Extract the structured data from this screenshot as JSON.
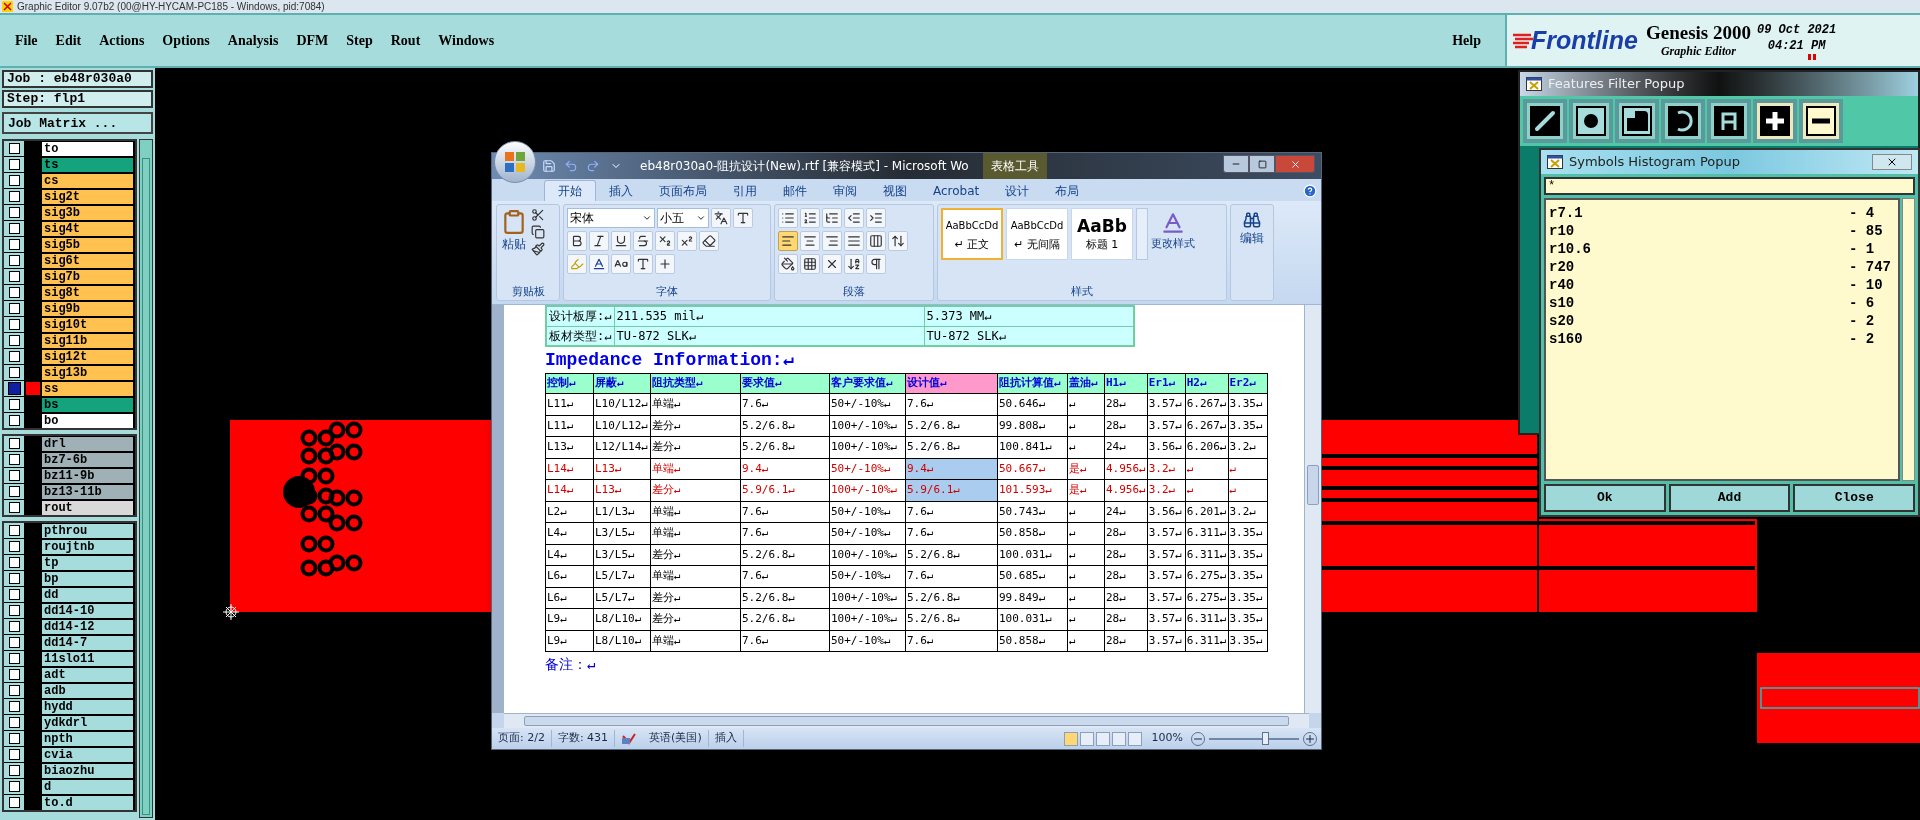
{
  "app_title": "Graphic Editor 9.07b2 (00@HY-HYCAM-PC185 - Windows, pid:7084)",
  "menu": [
    "File",
    "Edit",
    "Actions",
    "Options",
    "Analysis",
    "DFM",
    "Step",
    "Rout",
    "Windows"
  ],
  "help": "Help",
  "brand": {
    "logo": "Frontline",
    "product": "Genesis 2000",
    "subtitle": "Graphic Editor",
    "date": "09 Oct 2021",
    "time": "04:21 PM"
  },
  "job": {
    "job": "Job : eb48r030a0",
    "step": "Step: flp1",
    "matrix_button": "Job Matrix ..."
  },
  "layer_groups": [
    [
      {
        "name": "to",
        "color": "#ffffff",
        "selected": false
      },
      {
        "name": "ts",
        "color": "#14a37c",
        "selected": false
      },
      {
        "name": "cs",
        "color": "#ffc14f",
        "selected": false
      },
      {
        "name": "sig2t",
        "color": "#ffc14f",
        "selected": false
      },
      {
        "name": "sig3b",
        "color": "#ffc14f",
        "selected": false
      },
      {
        "name": "sig4t",
        "color": "#ffc14f",
        "selected": false
      },
      {
        "name": "sig5b",
        "color": "#ffc14f",
        "selected": false
      },
      {
        "name": "sig6t",
        "color": "#ffc14f",
        "selected": false
      },
      {
        "name": "sig7b",
        "color": "#ffc14f",
        "selected": false
      },
      {
        "name": "sig8t",
        "color": "#ffc14f",
        "selected": false
      },
      {
        "name": "sig9b",
        "color": "#ffc14f",
        "selected": false
      },
      {
        "name": "sig10t",
        "color": "#ffc14f",
        "selected": false
      },
      {
        "name": "sig11b",
        "color": "#ffc14f",
        "selected": false
      },
      {
        "name": "sig12t",
        "color": "#ffc14f",
        "selected": false
      },
      {
        "name": "sig13b",
        "color": "#ffc14f",
        "selected": false
      },
      {
        "name": "ss",
        "color": "#ffc14f",
        "selected": true
      },
      {
        "name": "bs",
        "color": "#14a37c",
        "selected": false
      },
      {
        "name": "bo",
        "color": "#ffffff",
        "selected": false
      }
    ],
    [
      {
        "name": "drl",
        "color": "#9fb0b6",
        "selected": false
      },
      {
        "name": "bz7-6b",
        "color": "#9fb0b6",
        "selected": false
      },
      {
        "name": "bz11-9b",
        "color": "#9fb0b6",
        "selected": false
      },
      {
        "name": "bz13-11b",
        "color": "#9fb0b6",
        "selected": false
      },
      {
        "name": "rout",
        "color": "#d9d9d9",
        "selected": false
      }
    ],
    [
      {
        "name": "pthrou",
        "color": "#a6dcdc",
        "selected": false
      },
      {
        "name": "roujtnb",
        "color": "#a6dcdc",
        "selected": false
      },
      {
        "name": "tp",
        "color": "#a6dcdc",
        "selected": false
      },
      {
        "name": "bp",
        "color": "#a6dcdc",
        "selected": false
      },
      {
        "name": "dd",
        "color": "#a6dcdc",
        "selected": false
      },
      {
        "name": "dd14-10",
        "color": "#a6dcdc",
        "selected": false
      },
      {
        "name": "dd14-12",
        "color": "#a6dcdc",
        "selected": false
      },
      {
        "name": "dd14-7",
        "color": "#a6dcdc",
        "selected": false
      },
      {
        "name": "11slo11",
        "color": "#a6dcdc",
        "selected": false
      },
      {
        "name": "adt",
        "color": "#a6dcdc",
        "selected": false
      },
      {
        "name": "adb",
        "color": "#a6dcdc",
        "selected": false
      },
      {
        "name": "hydd",
        "color": "#a6dcdc",
        "selected": false
      },
      {
        "name": "ydkdrl",
        "color": "#a6dcdc",
        "selected": false
      },
      {
        "name": "npth",
        "color": "#a6dcdc",
        "selected": false
      },
      {
        "name": "cvia",
        "color": "#a6dcdc",
        "selected": false
      },
      {
        "name": "biaozhu",
        "color": "#a6dcdc",
        "selected": false
      },
      {
        "name": "d",
        "color": "#a6dcdc",
        "selected": false
      },
      {
        "name": "to.d",
        "color": "#a6dcdc",
        "selected": false
      }
    ]
  ],
  "word": {
    "title": "eb48r030a0-阻抗设计(New).rtf [兼容模式] - Microsoft Wo",
    "context_tab": "表格工具",
    "tabs": [
      {
        "label": "开始",
        "selected": true
      },
      {
        "label": "插入",
        "selected": false
      },
      {
        "label": "页面布局",
        "selected": false
      },
      {
        "label": "引用",
        "selected": false
      },
      {
        "label": "邮件",
        "selected": false
      },
      {
        "label": "审阅",
        "selected": false
      },
      {
        "label": "视图",
        "selected": false
      },
      {
        "label": "Acrobat",
        "selected": false
      },
      {
        "label": "设计",
        "selected": false
      },
      {
        "label": "布局",
        "selected": false
      }
    ],
    "paste": "粘贴",
    "font": "宋体",
    "size": "小五",
    "styles": [
      {
        "preview": "AaBbCcDd",
        "label": "↵ 正文",
        "selected": true
      },
      {
        "preview": "AaBbCcDd",
        "label": "↵ 无间隔",
        "selected": false
      },
      {
        "preview": "AaBb",
        "label": "标题 1",
        "selected": false
      }
    ],
    "change_styles": "更改样式",
    "edit": "编辑",
    "group_labels": [
      "剪贴板",
      "字体",
      "段落",
      "样式"
    ],
    "board_rows": [
      [
        "设计板厚:↵",
        "211.535 mil↵",
        "5.373 MM↵"
      ],
      [
        "板材类型:↵",
        "TU-872 SLK↵",
        "TU-872 SLK↵"
      ]
    ],
    "heading": "Impedance Information:↵",
    "columns": [
      {
        "label": "控制↵",
        "kind": "plain"
      },
      {
        "label": "屏蔽↵",
        "kind": "plain"
      },
      {
        "label": "阻抗类型↵",
        "kind": "plain"
      },
      {
        "label": "要求值↵",
        "kind": "plain"
      },
      {
        "label": "客户要求值↵",
        "kind": "plain"
      },
      {
        "label": "设计值↵",
        "kind": "marked"
      },
      {
        "label": "阻抗计算值↵",
        "kind": "plain"
      },
      {
        "label": "盖油↵",
        "kind": "plain"
      },
      {
        "label": "H1↵",
        "kind": "plain"
      },
      {
        "label": "Er1↵",
        "kind": "plain"
      },
      {
        "label": "H2↵",
        "kind": "plain"
      },
      {
        "label": "Er2↵",
        "kind": "plain"
      }
    ],
    "rows": [
      {
        "kind": "normal",
        "design_cell_selected": false,
        "cells": [
          "L11↵",
          "L10/L12↵",
          "单端↵",
          "7.6↵",
          "50+/-10%↵",
          "7.6↵",
          "50.646↵",
          "↵",
          "28↵",
          "3.57↵",
          "6.267↵",
          "3.35↵"
        ]
      },
      {
        "kind": "normal",
        "design_cell_selected": false,
        "cells": [
          "L11↵",
          "L10/L12↵",
          "差分↵",
          "5.2/6.8↵",
          "100+/-10%↵",
          "5.2/6.8↵",
          "99.808↵",
          "↵",
          "28↵",
          "3.57↵",
          "6.267↵",
          "3.35↵"
        ]
      },
      {
        "kind": "normal",
        "design_cell_selected": false,
        "cells": [
          "L13↵",
          "L12/L14↵",
          "差分↵",
          "5.2/6.8↵",
          "100+/-10%↵",
          "5.2/6.8↵",
          "100.841↵",
          "↵",
          "24↵",
          "3.56↵",
          "6.206↵",
          "3.2↵"
        ]
      },
      {
        "kind": "flagged",
        "design_cell_selected": true,
        "cells": [
          "L14↵",
          "L13↵",
          "单端↵",
          "9.4↵",
          "50+/-10%↵",
          "9.4↵",
          "50.667↵",
          "是↵",
          "4.956↵",
          "3.2↵",
          "↵",
          "↵"
        ]
      },
      {
        "kind": "flagged",
        "design_cell_selected": true,
        "cells": [
          "L14↵",
          "L13↵",
          "差分↵",
          "5.9/6.1↵",
          "100+/-10%↵",
          "5.9/6.1↵",
          "101.593↵",
          "是↵",
          "4.956↵",
          "3.2↵",
          "↵",
          "↵"
        ]
      },
      {
        "kind": "normal",
        "design_cell_selected": false,
        "cells": [
          "L2↵",
          "L1/L3↵",
          "单端↵",
          "7.6↵",
          "50+/-10%↵",
          "7.6↵",
          "50.743↵",
          "↵",
          "24↵",
          "3.56↵",
          "6.201↵",
          "3.2↵"
        ]
      },
      {
        "kind": "normal",
        "design_cell_selected": false,
        "cells": [
          "L4↵",
          "L3/L5↵",
          "单端↵",
          "7.6↵",
          "50+/-10%↵",
          "7.6↵",
          "50.858↵",
          "↵",
          "28↵",
          "3.57↵",
          "6.311↵",
          "3.35↵"
        ]
      },
      {
        "kind": "normal",
        "design_cell_selected": false,
        "cells": [
          "L4↵",
          "L3/L5↵",
          "差分↵",
          "5.2/6.8↵",
          "100+/-10%↵",
          "5.2/6.8↵",
          "100.031↵",
          "↵",
          "28↵",
          "3.57↵",
          "6.311↵",
          "3.35↵"
        ]
      },
      {
        "kind": "normal",
        "design_cell_selected": false,
        "cells": [
          "L6↵",
          "L5/L7↵",
          "单端↵",
          "7.6↵",
          "50+/-10%↵",
          "7.6↵",
          "50.685↵",
          "↵",
          "28↵",
          "3.57↵",
          "6.275↵",
          "3.35↵"
        ]
      },
      {
        "kind": "normal",
        "design_cell_selected": false,
        "cells": [
          "L6↵",
          "L5/L7↵",
          "差分↵",
          "5.2/6.8↵",
          "100+/-10%↵",
          "5.2/6.8↵",
          "99.849↵",
          "↵",
          "28↵",
          "3.57↵",
          "6.275↵",
          "3.35↵"
        ]
      },
      {
        "kind": "normal",
        "design_cell_selected": false,
        "cells": [
          "L9↵",
          "L8/L10↵",
          "差分↵",
          "5.2/6.8↵",
          "100+/-10%↵",
          "5.2/6.8↵",
          "100.031↵",
          "↵",
          "28↵",
          "3.57↵",
          "6.311↵",
          "3.35↵"
        ]
      },
      {
        "kind": "normal",
        "design_cell_selected": false,
        "cells": [
          "L9↵",
          "L8/L10↵",
          "单端↵",
          "7.6↵",
          "50+/-10%↵",
          "7.6↵",
          "50.858↵",
          "↵",
          "28↵",
          "3.57↵",
          "6.311↵",
          "3.35↵"
        ]
      }
    ],
    "remark": "备注：↵",
    "status": [
      "页面: 2/2",
      "字数: 431",
      "英语(美国)",
      "插入"
    ],
    "zoom": {
      "reading": "100%",
      "level": 0.62
    }
  },
  "features_filter": {
    "title": "Features Filter Popup",
    "tools": [
      {
        "kind": "line",
        "selected": false
      },
      {
        "kind": "pad",
        "selected": false
      },
      {
        "kind": "surface",
        "selected": false
      },
      {
        "kind": "arc",
        "selected": false
      },
      {
        "kind": "text",
        "selected": false
      },
      {
        "kind": "plus",
        "selected": true
      },
      {
        "kind": "minus",
        "selected": true
      }
    ]
  },
  "histogram": {
    "title": "Symbols Histogram Popup",
    "filter": "*",
    "symbols": [
      {
        "name": "r7.1",
        "count": "- 4"
      },
      {
        "name": "r10",
        "count": "- 85"
      },
      {
        "name": "r10.6",
        "count": "- 1"
      },
      {
        "name": "r20",
        "count": "- 747"
      },
      {
        "name": "r40",
        "count": "- 10"
      },
      {
        "name": "s10",
        "count": "- 6"
      },
      {
        "name": "s20",
        "count": "- 2"
      },
      {
        "name": "s160",
        "count": "- 2"
      }
    ],
    "buttons": [
      "Ok",
      "Add",
      "Close"
    ]
  }
}
